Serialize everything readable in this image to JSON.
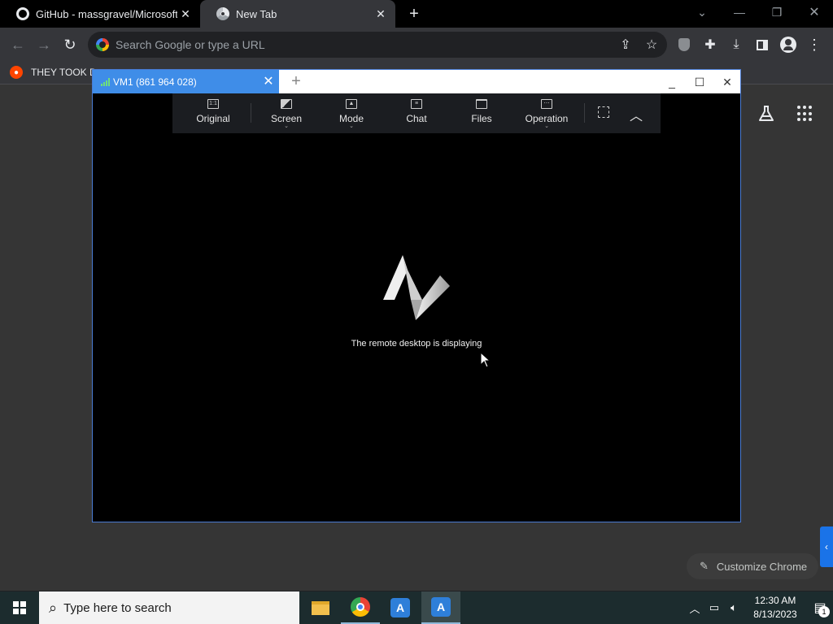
{
  "browser": {
    "tabs": [
      {
        "title": "GitHub - massgravel/Microsoft-A",
        "active": false,
        "icon": "github-icon"
      },
      {
        "title": "New Tab",
        "active": true,
        "icon": "chrome-icon"
      }
    ],
    "omnibox": {
      "placeholder": "Search Google or type a URL"
    },
    "bookmarks": [
      {
        "label": "THEY TOOK D",
        "icon": "reddit-icon"
      }
    ],
    "customize_label": "Customize Chrome"
  },
  "anydesk": {
    "tab_title": "VM1 (861 964 028)",
    "toolbar": [
      {
        "label": "Original",
        "icon": "one-to-one-icon",
        "dropdown": false
      },
      {
        "label": "Screen",
        "icon": "screen-icon",
        "dropdown": true
      },
      {
        "label": "Mode",
        "icon": "image-icon",
        "dropdown": true
      },
      {
        "label": "Chat",
        "icon": "chat-icon",
        "dropdown": false
      },
      {
        "label": "Files",
        "icon": "folder-icon",
        "dropdown": false
      },
      {
        "label": "Operation",
        "icon": "keyboard-icon",
        "dropdown": true
      }
    ],
    "status_text": "The remote desktop is displaying",
    "accent_color": "#3f8de8"
  },
  "taskbar": {
    "search_placeholder": "Type here to search",
    "apps": [
      "file-explorer-icon",
      "chrome-icon",
      "anydesk-icon",
      "anydesk-icon"
    ],
    "clock_time": "12:30 AM",
    "clock_date": "8/13/2023",
    "notification_count": "1"
  }
}
